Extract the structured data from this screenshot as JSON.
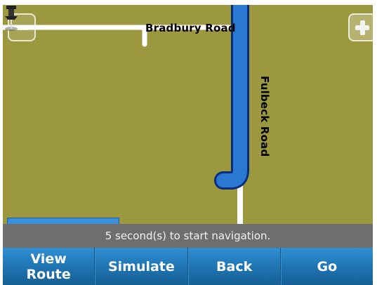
{
  "map": {
    "roads": {
      "bradbury_road": "Bradbury Road",
      "fulbeck_road": "Fulbeck Road"
    },
    "icons": {
      "zoom_out": "minus-icon",
      "zoom_in": "plus-icon",
      "marker": "pushpin-icon"
    },
    "colors": {
      "land": "#9c9840",
      "route": "#2a78d2",
      "road": "#ffffff"
    }
  },
  "status": {
    "message": "5 second(s) to start navigation."
  },
  "toolbar": {
    "view_route_label": "View\nRoute",
    "simulate_label": "Simulate",
    "back_label": "Back",
    "go_label": "Go"
  }
}
